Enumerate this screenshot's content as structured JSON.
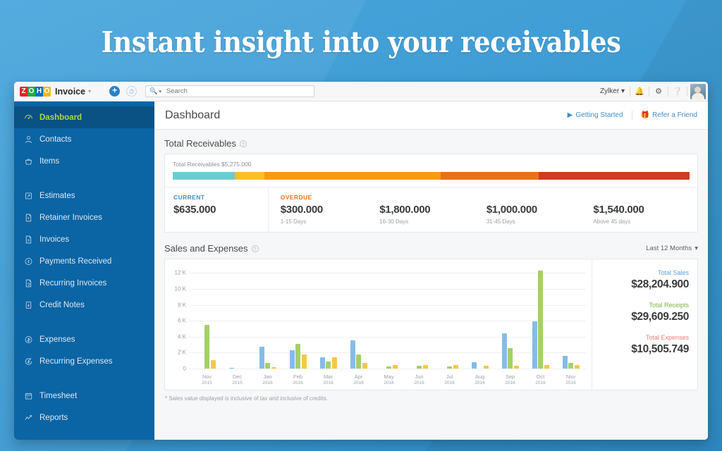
{
  "banner": {
    "headline": "Instant insight into your receivables"
  },
  "topbar": {
    "logo_letters": [
      "Z",
      "O",
      "H",
      "O"
    ],
    "product": "Invoice",
    "product_caret": "▾",
    "add_icon": "plus-icon",
    "recent_icon": "clock-icon",
    "search": {
      "icon": "search-icon",
      "caret": "▾",
      "placeholder": "Search",
      "value": ""
    },
    "org": "Zylker",
    "org_caret": "▾",
    "notifications_icon": "bell-icon",
    "settings_icon": "gear-icon",
    "help_icon": "help-icon",
    "avatar": "user-avatar"
  },
  "sidebar": {
    "items": [
      {
        "label": "Dashboard",
        "icon": "dashboard-icon",
        "active": true
      },
      {
        "label": "Contacts",
        "icon": "contacts-icon",
        "active": false
      },
      {
        "label": "Items",
        "icon": "items-icon",
        "active": false
      },
      {
        "label": "Estimates",
        "icon": "estimates-icon",
        "active": false
      },
      {
        "label": "Retainer Invoices",
        "icon": "retainer-invoice-icon",
        "active": false
      },
      {
        "label": "Invoices",
        "icon": "invoice-icon",
        "active": false
      },
      {
        "label": "Payments Received",
        "icon": "payments-received-icon",
        "active": false
      },
      {
        "label": "Recurring Invoices",
        "icon": "recurring-invoice-icon",
        "active": false
      },
      {
        "label": "Credit Notes",
        "icon": "credit-note-icon",
        "active": false
      },
      {
        "label": "Expenses",
        "icon": "expenses-icon",
        "active": false
      },
      {
        "label": "Recurring Expenses",
        "icon": "recurring-expenses-icon",
        "active": false
      },
      {
        "label": "Timesheet",
        "icon": "timesheet-icon",
        "active": false
      },
      {
        "label": "Reports",
        "icon": "reports-icon",
        "active": false
      }
    ]
  },
  "page": {
    "title": "Dashboard",
    "getting_started": "Getting Started",
    "getting_started_icon": "play-circle-icon",
    "refer_a_friend": "Refer a Friend",
    "refer_icon": "gift-icon"
  },
  "receivables": {
    "section_title": "Total Receivables",
    "info_icon": "info-icon",
    "bar_caption": "Total Receivables $5,275.000",
    "total": "$5,275.000",
    "segments": [
      {
        "name": "Current",
        "color": "#6ecbd1",
        "pct": 12.0
      },
      {
        "name": "1-15 Days",
        "color": "#fbbd2a",
        "pct": 5.7
      },
      {
        "name": "16-30 Days",
        "color": "#f59b12",
        "pct": 34.1
      },
      {
        "name": "31-45 Days",
        "color": "#e8711b",
        "pct": 19.0
      },
      {
        "name": "Above 45 days",
        "color": "#cf3d22",
        "pct": 29.2
      }
    ],
    "current": {
      "tag": "CURRENT",
      "value": "$635.000"
    },
    "overdue_tag": "OVERDUE",
    "buckets": [
      {
        "value": "$300.000",
        "period": "1-15 Days"
      },
      {
        "value": "$1,800.000",
        "period": "16-30 Days"
      },
      {
        "value": "$1,000.000",
        "period": "31-45 Days"
      },
      {
        "value": "$1,540.000",
        "period": "Above 45 days"
      }
    ]
  },
  "sales_expenses": {
    "section_title": "Sales and Expenses",
    "info_icon": "info-icon",
    "range_label": "Last 12 Months",
    "range_caret": "▾",
    "totals": [
      {
        "label": "Total Sales",
        "value": "$28,204.900",
        "key": "sales"
      },
      {
        "label": "Total Receipts",
        "value": "$29,609.250",
        "key": "receipts"
      },
      {
        "label": "Total Expenses",
        "value": "$10,505.749",
        "key": "expenses"
      }
    ],
    "footnote": "* Sales value displayed is inclusive of tax and inclusive of credits."
  },
  "chart_data": {
    "type": "bar",
    "title": "Sales and Expenses",
    "xlabel": "",
    "ylabel": "",
    "ylim": [
      0,
      13000
    ],
    "yticks": [
      0,
      2000,
      4000,
      6000,
      8000,
      10000,
      12000
    ],
    "ytick_labels": [
      "0",
      "2 K",
      "4 K",
      "6 K",
      "8 K",
      "10 K",
      "12 K"
    ],
    "grid": true,
    "legend": "right-panel",
    "categories": [
      {
        "month": "Nov",
        "year": "2015"
      },
      {
        "month": "Dec",
        "year": "2015"
      },
      {
        "month": "Jan",
        "year": "2016"
      },
      {
        "month": "Feb",
        "year": "2016"
      },
      {
        "month": "Mar",
        "year": "2016"
      },
      {
        "month": "Apr",
        "year": "2016"
      },
      {
        "month": "May",
        "year": "2016"
      },
      {
        "month": "Jun",
        "year": "2016"
      },
      {
        "month": "Jul",
        "year": "2016"
      },
      {
        "month": "Aug",
        "year": "2016"
      },
      {
        "month": "Sep",
        "year": "2016"
      },
      {
        "month": "Oct",
        "year": "2016"
      },
      {
        "month": "Nov",
        "year": "2016"
      }
    ],
    "series": [
      {
        "name": "Total Sales",
        "color": "#84bde8",
        "values": [
          0,
          60,
          2700,
          2300,
          1450,
          3550,
          0,
          0,
          0,
          800,
          4400,
          5900,
          1600
        ]
      },
      {
        "name": "Total Receipts",
        "color": "#a5cf6b",
        "values": [
          5500,
          0,
          700,
          3100,
          900,
          1750,
          300,
          350,
          300,
          0,
          2550,
          12300,
          700
        ]
      },
      {
        "name": "Total Expenses",
        "color": "#f6c944",
        "values": [
          1100,
          0,
          200,
          1800,
          1450,
          750,
          450,
          450,
          450,
          350,
          350,
          400,
          450
        ]
      }
    ]
  }
}
